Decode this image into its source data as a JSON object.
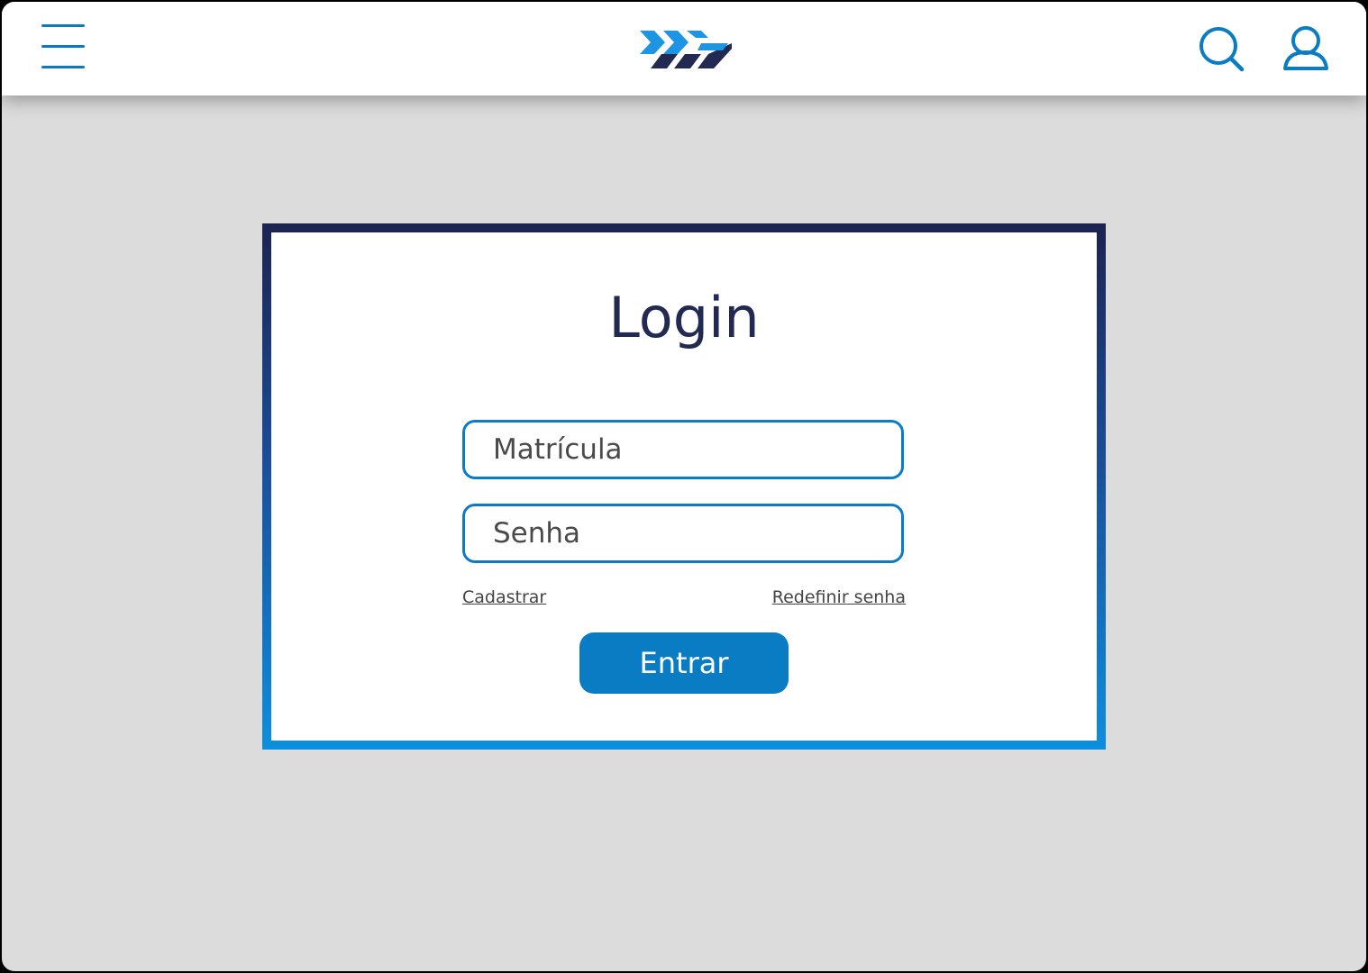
{
  "header": {
    "menu_icon": "hamburger-menu-icon",
    "logo_icon": "chevrons-logo-icon",
    "search_icon": "search-icon",
    "user_icon": "user-icon"
  },
  "login": {
    "title": "Login",
    "matricula_placeholder": "Matrícula",
    "senha_placeholder": "Senha",
    "cadastrar_link": "Cadastrar",
    "redefinir_link": "Redefinir senha",
    "entrar_button": "Entrar"
  },
  "colors": {
    "accent": "#0a7cc4",
    "title": "#232a52",
    "background": "#dcdcdc"
  }
}
